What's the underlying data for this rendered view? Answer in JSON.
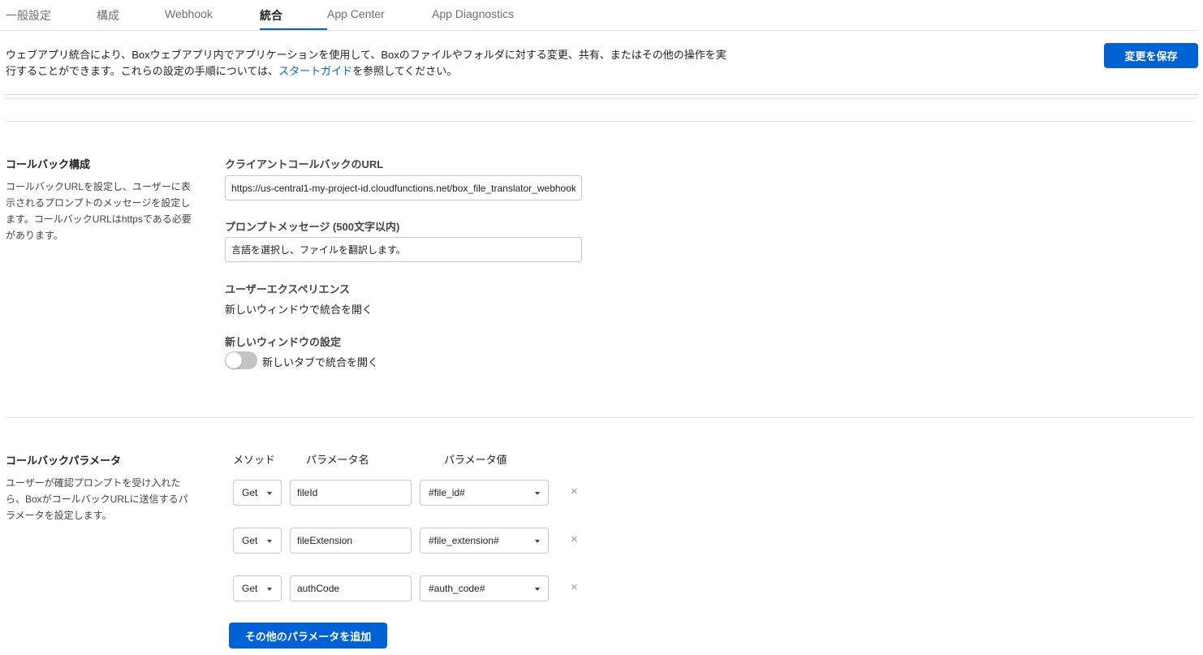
{
  "tabs": [
    {
      "label": "一般設定"
    },
    {
      "label": "構成"
    },
    {
      "label": "Webhook"
    },
    {
      "label": "統合"
    },
    {
      "label": "App Center"
    },
    {
      "label": "App Diagnostics"
    }
  ],
  "intro": {
    "text_before_link": "ウェブアプリ統合により、Boxウェブアプリ内でアプリケーションを使用して、Boxのファイルやフォルダに対する変更、共有、またはその他の操作を実行することができます。これらの設定の手順については、",
    "link": "スタートガイド",
    "text_after_link": "を参照してください。",
    "save_button": "変更を保存"
  },
  "callback_config": {
    "title": "コールバック構成",
    "description": "コールバックURLを設定し、ユーザーに表示されるプロンプトのメッセージを設定します。コールバックURLはhttpsである必要があります。",
    "url_label": "クライアントコールバックのURL",
    "url_value": "https://us-central1-my-project-id.cloudfunctions.net/box_file_translator_webhook",
    "prompt_label": "プロンプトメッセージ (500文字以内)",
    "prompt_value": "言語を選択し、ファイルを翻訳します。",
    "ux_label": "ユーザーエクスペリエンス",
    "ux_value": "新しいウィンドウで統合を開く",
    "window_label": "新しいウィンドウの設定",
    "toggle_label": "新しいタブで統合を開く",
    "toggle_on": false
  },
  "callback_params": {
    "title": "コールバックパラメータ",
    "description": "ユーザーが確認プロンプトを受け入れたら、BoxがコールバックURLに送信するパラメータを設定します。",
    "col_method": "メソッド",
    "col_name": "パラメータ名",
    "col_value": "パラメータ値",
    "rows": [
      {
        "method": "Get",
        "name": "fileId",
        "value": "#file_id#"
      },
      {
        "method": "Get",
        "name": "fileExtension",
        "value": "#file_extension#"
      },
      {
        "method": "Get",
        "name": "authCode",
        "value": "#auth_code#"
      }
    ],
    "remove_symbol": "×",
    "add_button": "その他のパラメータを追加"
  }
}
